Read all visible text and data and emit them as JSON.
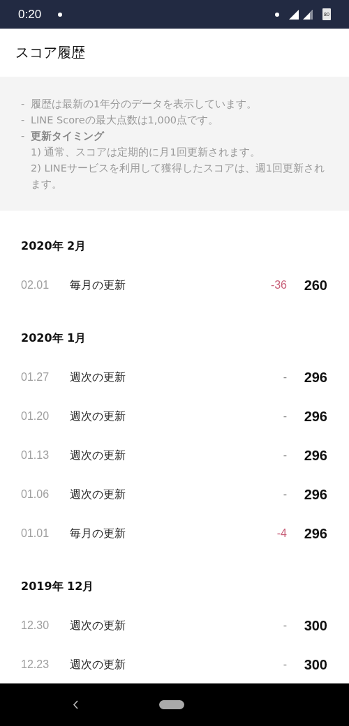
{
  "status_bar": {
    "time": "0:20",
    "battery": "80"
  },
  "header": {
    "title": "スコア履歴"
  },
  "notice": {
    "items": [
      {
        "marker": "-",
        "text": "履歴は最新の1年分のデータを表示しています。",
        "bold": false
      },
      {
        "marker": "-",
        "text": "LINE Scoreの最大点数は1,000点です。",
        "bold": false
      },
      {
        "marker": "-",
        "text": "更新タイミング",
        "bold": true,
        "details": [
          "1) 通常、スコアは定期的に月1回更新されます。",
          "2) LINEサービスを利用して獲得したスコアは、週1回更新されます。"
        ]
      }
    ]
  },
  "history": [
    {
      "month": "2020年 2月",
      "rows": [
        {
          "date": "02.01",
          "label": "毎月の更新",
          "change": "-36",
          "kind": "decrease",
          "score": "260"
        }
      ]
    },
    {
      "month": "2020年 1月",
      "rows": [
        {
          "date": "01.27",
          "label": "週次の更新",
          "change": "-",
          "kind": "none",
          "score": "296"
        },
        {
          "date": "01.20",
          "label": "週次の更新",
          "change": "-",
          "kind": "none",
          "score": "296"
        },
        {
          "date": "01.13",
          "label": "週次の更新",
          "change": "-",
          "kind": "none",
          "score": "296"
        },
        {
          "date": "01.06",
          "label": "週次の更新",
          "change": "-",
          "kind": "none",
          "score": "296"
        },
        {
          "date": "01.01",
          "label": "毎月の更新",
          "change": "-4",
          "kind": "decrease",
          "score": "296"
        }
      ]
    },
    {
      "month": "2019年 12月",
      "rows": [
        {
          "date": "12.30",
          "label": "週次の更新",
          "change": "-",
          "kind": "none",
          "score": "300"
        },
        {
          "date": "12.23",
          "label": "週次の更新",
          "change": "-",
          "kind": "none",
          "score": "300"
        }
      ]
    }
  ]
}
